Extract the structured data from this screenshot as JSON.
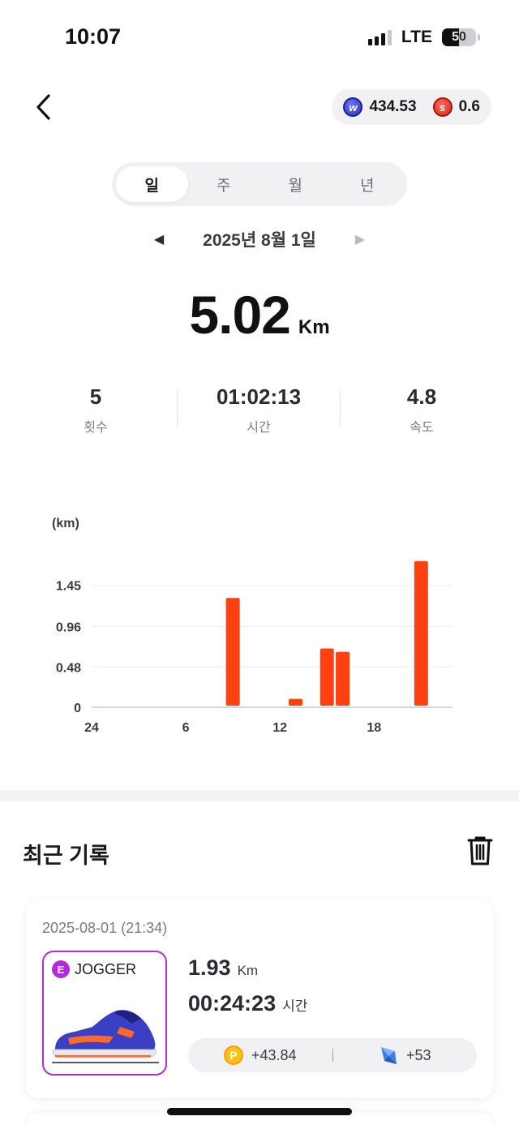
{
  "status_bar": {
    "time": "10:07",
    "network": "LTE",
    "battery": "50"
  },
  "header": {
    "coins": [
      {
        "icon": "w-coin-icon",
        "value": "434.53"
      },
      {
        "icon": "s-coin-icon",
        "value": "0.6"
      }
    ]
  },
  "tabs": [
    {
      "label": "일",
      "active": true
    },
    {
      "label": "주",
      "active": false
    },
    {
      "label": "월",
      "active": false
    },
    {
      "label": "년",
      "active": false
    }
  ],
  "date_nav": {
    "prev": "◀",
    "date": "2025년 8월 1일",
    "next": "▶"
  },
  "summary": {
    "distance": "5.02",
    "unit": "Km"
  },
  "stats": [
    {
      "value": "5",
      "label": "횟수"
    },
    {
      "value": "01:02:13",
      "label": "시간"
    },
    {
      "value": "4.8",
      "label": "속도"
    }
  ],
  "chart_data": {
    "type": "bar",
    "ylabel": "(km)",
    "yticks": [
      "0",
      "0.48",
      "0.96",
      "1.45"
    ],
    "ytick_values": [
      0,
      0.48,
      0.96,
      1.45
    ],
    "ylim": [
      0,
      1.93
    ],
    "xticks": [
      "24",
      "6",
      "12",
      "18"
    ],
    "xtick_values": [
      0,
      6,
      12,
      18
    ],
    "xlim": [
      0,
      23
    ],
    "grid": true,
    "color": "#ff4010",
    "bars": [
      {
        "hour": 9,
        "value": 1.3
      },
      {
        "hour": 13,
        "value": 0.1
      },
      {
        "hour": 15,
        "value": 0.7
      },
      {
        "hour": 16,
        "value": 0.66
      },
      {
        "hour": 21,
        "value": 1.74
      }
    ]
  },
  "recent": {
    "title": "최근 기록",
    "records": [
      {
        "datetime": "2025-08-01 (21:34)",
        "grade": "E",
        "shoe": "JOGGER",
        "distance": "1.93",
        "distance_unit": "Km",
        "duration": "00:24:23",
        "duration_unit": "시간",
        "point_icon_label": "P",
        "points": "+43.84",
        "gems": "+53"
      }
    ]
  },
  "colors": {
    "accent_bar": "#ff4010",
    "grade_border": "#b629d8",
    "point_coin": "#ffbf1a"
  }
}
